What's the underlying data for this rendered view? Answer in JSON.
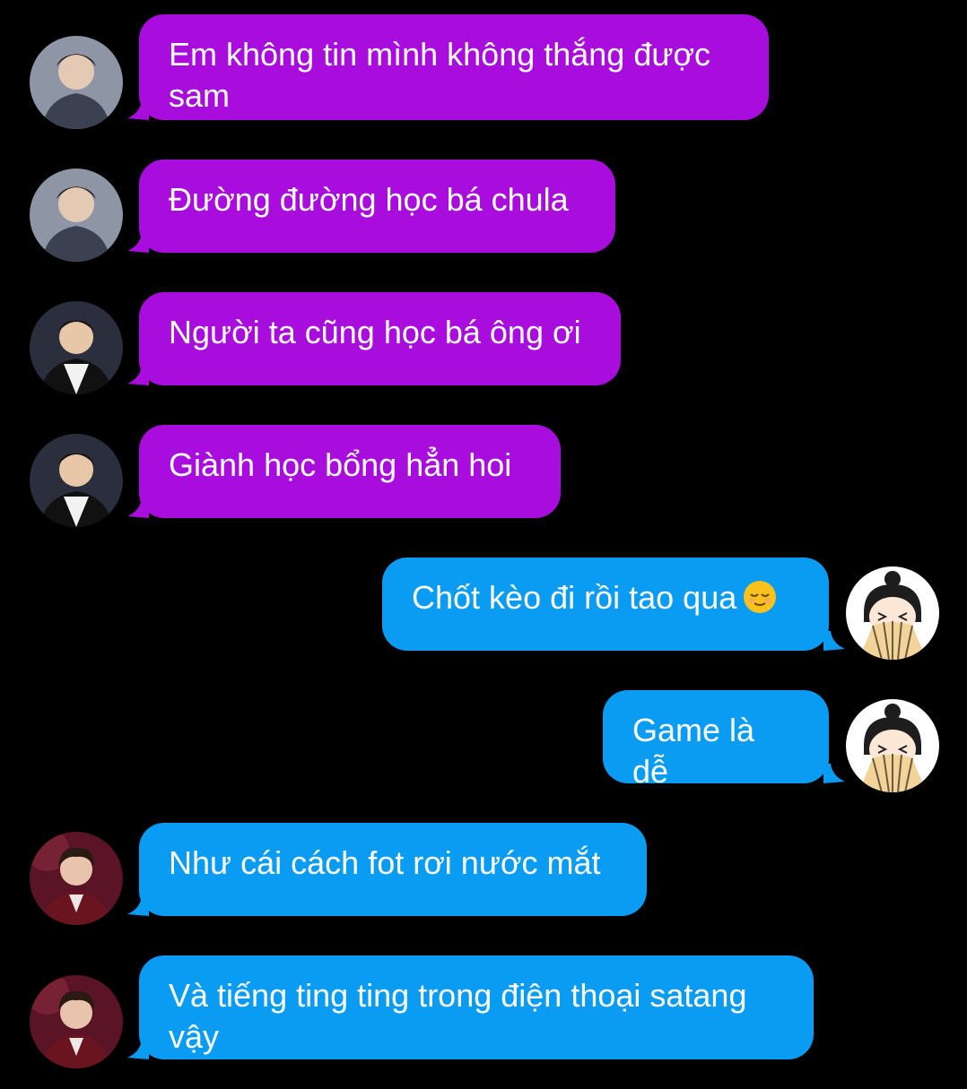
{
  "messages": [
    {
      "side": "left",
      "color": "purple",
      "avatar": "male-portrait-1",
      "text": "Em không tin mình không thắng được sam"
    },
    {
      "side": "left",
      "color": "purple",
      "avatar": "male-portrait-1",
      "text": "Đường đường học bá chula"
    },
    {
      "side": "left",
      "color": "purple",
      "avatar": "male-portrait-2",
      "text": "Người ta cũng học bá ông ơi"
    },
    {
      "side": "left",
      "color": "purple",
      "avatar": "male-portrait-2",
      "text": "Giành học bổng hẳn hoi"
    },
    {
      "side": "right",
      "color": "blue",
      "avatar": "cartoon-fan-girl",
      "text": "Chốt kèo đi rồi tao qua",
      "emoji": "relieved-face-emoji"
    },
    {
      "side": "right",
      "color": "blue",
      "avatar": "cartoon-fan-girl",
      "text": "Game là dễ"
    },
    {
      "side": "left",
      "color": "blue",
      "avatar": "male-portrait-3",
      "text": "Như cái cách fot rơi nước mắt"
    },
    {
      "side": "left",
      "color": "blue",
      "avatar": "male-portrait-3",
      "text": "Và tiếng ting ting trong điện thoại satang vậy"
    }
  ],
  "colors": {
    "background": "#000000",
    "purple_bubble": "#a80ddd",
    "blue_bubble": "#0a9bf2",
    "text": "#ffffff"
  }
}
